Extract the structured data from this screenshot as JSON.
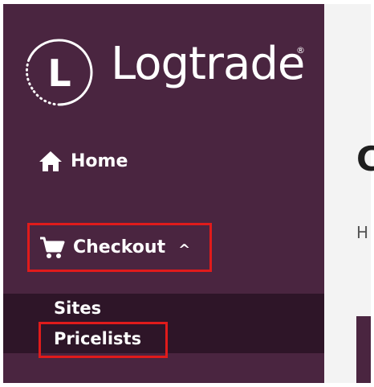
{
  "brand": {
    "name": "Logtrade",
    "registered_mark": "®",
    "logo_letter": "L"
  },
  "sidebar": {
    "items": [
      {
        "label": "Home",
        "icon": "home-icon"
      },
      {
        "label": "Checkout",
        "icon": "cart-icon",
        "expanded": true,
        "chevron": "^"
      }
    ],
    "submenu": [
      {
        "label": "Sites"
      },
      {
        "label": "Pricelists",
        "highlighted": true
      }
    ]
  },
  "main": {
    "heading_fragment": "C",
    "breadcrumb_fragment": "H"
  },
  "colors": {
    "sidebar_bg": "#4a2540",
    "submenu_bg": "#2e1528",
    "highlight_border": "#e01b1b",
    "main_bg": "#f3f3f3"
  }
}
